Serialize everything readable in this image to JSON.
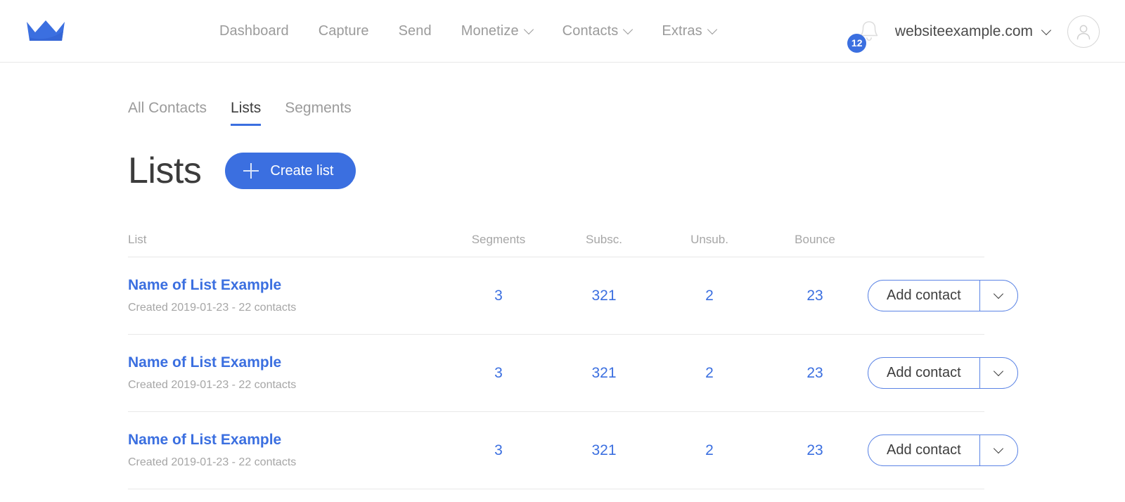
{
  "header": {
    "logo_icon": "crown-logo-icon",
    "nav": [
      {
        "label": "Dashboard",
        "has_dropdown": false
      },
      {
        "label": "Capture",
        "has_dropdown": false
      },
      {
        "label": "Send",
        "has_dropdown": false
      },
      {
        "label": "Monetize",
        "has_dropdown": true
      },
      {
        "label": "Contacts",
        "has_dropdown": true
      },
      {
        "label": "Extras",
        "has_dropdown": true
      }
    ],
    "notifications": {
      "icon": "bell-icon",
      "badge_count": "12"
    },
    "account": {
      "name": "websiteexample.com",
      "chevron_icon": "chevron-down-icon",
      "avatar_icon": "user-avatar-icon"
    }
  },
  "tabs": [
    {
      "label": "All Contacts",
      "active": false
    },
    {
      "label": "Lists",
      "active": true
    },
    {
      "label": "Segments",
      "active": false
    }
  ],
  "main": {
    "title": "Lists",
    "create_button": {
      "label": "Create list",
      "icon": "plus-icon"
    }
  },
  "table": {
    "columns": [
      {
        "key": "list",
        "label": "List"
      },
      {
        "key": "segments",
        "label": "Segments"
      },
      {
        "key": "subsc",
        "label": "Subsc."
      },
      {
        "key": "unsub",
        "label": "Unsub."
      },
      {
        "key": "bounce",
        "label": "Bounce"
      }
    ],
    "action_button": {
      "label": "Add contact",
      "dropdown_icon": "chevron-down-icon"
    },
    "rows": [
      {
        "name": "Name of List Example",
        "meta": "Created 2019-01-23 - 22 contacts",
        "segments": "3",
        "subsc": "321",
        "unsub": "2",
        "bounce": "23",
        "action_label": "Add contact"
      },
      {
        "name": "Name of List Example",
        "meta": "Created 2019-01-23 - 22 contacts",
        "segments": "3",
        "subsc": "321",
        "unsub": "2",
        "bounce": "23",
        "action_label": "Add contact"
      },
      {
        "name": "Name of List Example",
        "meta": "Created 2019-01-23 - 22 contacts",
        "segments": "3",
        "subsc": "321",
        "unsub": "2",
        "bounce": "23",
        "action_label": "Add contact"
      }
    ]
  },
  "colors": {
    "brand_blue": "#3b6fe0",
    "link_blue": "#3b6fe0",
    "text_dark": "#3c3c3c",
    "text_muted": "#a6a6a6",
    "border": "#e8e8e8"
  }
}
